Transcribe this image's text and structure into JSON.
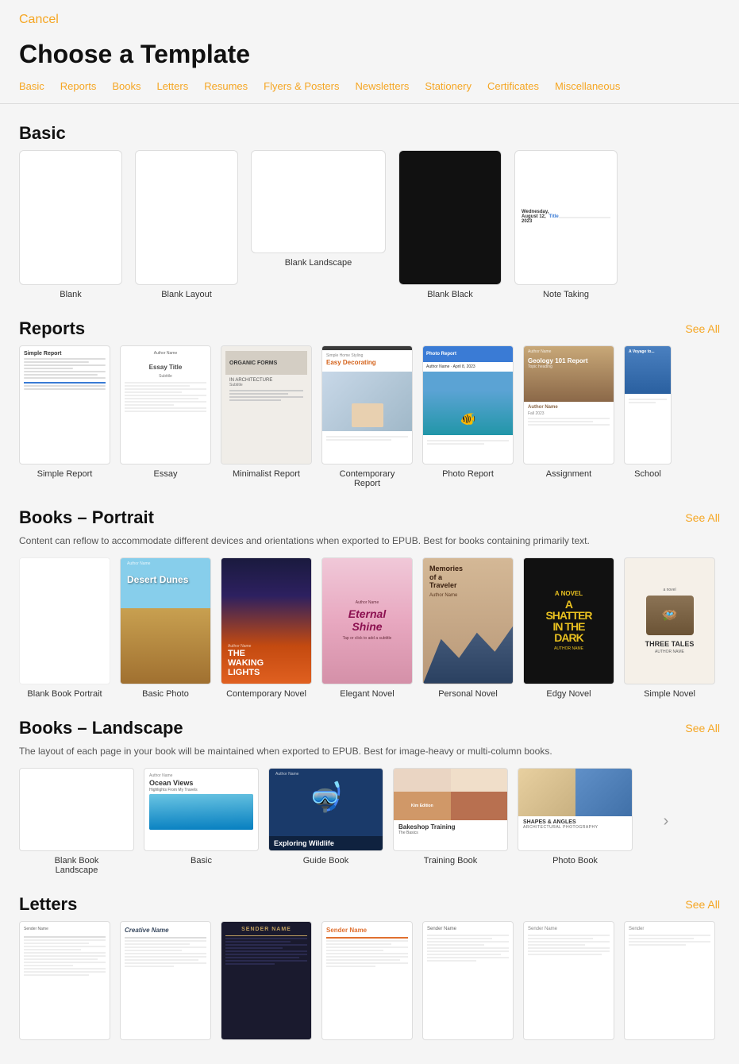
{
  "header": {
    "cancel_label": "Cancel",
    "title": "Choose a Template"
  },
  "nav": {
    "tabs": [
      {
        "id": "basic",
        "label": "Basic"
      },
      {
        "id": "reports",
        "label": "Reports"
      },
      {
        "id": "books",
        "label": "Books"
      },
      {
        "id": "letters",
        "label": "Letters"
      },
      {
        "id": "resumes",
        "label": "Resumes"
      },
      {
        "id": "flyers",
        "label": "Flyers & Posters"
      },
      {
        "id": "newsletters",
        "label": "Newsletters"
      },
      {
        "id": "stationery",
        "label": "Stationery"
      },
      {
        "id": "certificates",
        "label": "Certificates"
      },
      {
        "id": "miscellaneous",
        "label": "Miscellaneous"
      }
    ]
  },
  "sections": {
    "basic": {
      "title": "Basic",
      "templates": [
        {
          "id": "blank",
          "label": "Blank"
        },
        {
          "id": "blank-layout",
          "label": "Blank Layout"
        },
        {
          "id": "blank-landscape",
          "label": "Blank Landscape"
        },
        {
          "id": "blank-black",
          "label": "Blank Black"
        },
        {
          "id": "note-taking",
          "label": "Note Taking"
        }
      ]
    },
    "reports": {
      "title": "Reports",
      "see_all": "See All",
      "templates": [
        {
          "id": "simple-report",
          "label": "Simple Report"
        },
        {
          "id": "essay",
          "label": "Essay"
        },
        {
          "id": "minimalist-report",
          "label": "Minimalist Report"
        },
        {
          "id": "contemporary-report",
          "label": "Contemporary Report"
        },
        {
          "id": "photo-report",
          "label": "Photo Report"
        },
        {
          "id": "assignment",
          "label": "Assignment"
        },
        {
          "id": "school",
          "label": "School"
        }
      ]
    },
    "books_portrait": {
      "title": "Books – Portrait",
      "see_all": "See All",
      "subtitle": "Content can reflow to accommodate different devices and orientations when exported to EPUB. Best for books containing primarily text.",
      "templates": [
        {
          "id": "blank-book-portrait",
          "label": "Blank Book Portrait"
        },
        {
          "id": "basic-photo",
          "label": "Basic Photo"
        },
        {
          "id": "contemporary-novel",
          "label": "Contemporary Novel"
        },
        {
          "id": "elegant-novel",
          "label": "Elegant Novel"
        },
        {
          "id": "personal-novel",
          "label": "Personal Novel"
        },
        {
          "id": "edgy-novel",
          "label": "Edgy Novel"
        },
        {
          "id": "simple-novel",
          "label": "Simple Novel"
        }
      ]
    },
    "books_landscape": {
      "title": "Books – Landscape",
      "see_all": "See All",
      "subtitle": "The layout of each page in your book will be maintained when exported to EPUB. Best for image-heavy or multi-column books.",
      "templates": [
        {
          "id": "blank-book-landscape",
          "label": "Blank Book Landscape"
        },
        {
          "id": "basic",
          "label": "Basic"
        },
        {
          "id": "guide-book",
          "label": "Guide Book"
        },
        {
          "id": "training-book",
          "label": "Training Book"
        },
        {
          "id": "photo-book",
          "label": "Photo Book"
        }
      ]
    },
    "letters": {
      "title": "Letters",
      "see_all": "See All",
      "templates": [
        {
          "id": "letter-1",
          "label": ""
        },
        {
          "id": "letter-2",
          "label": ""
        },
        {
          "id": "letter-3",
          "label": ""
        },
        {
          "id": "letter-4",
          "label": ""
        },
        {
          "id": "letter-5",
          "label": ""
        },
        {
          "id": "letter-6",
          "label": ""
        },
        {
          "id": "letter-7",
          "label": ""
        }
      ]
    }
  }
}
